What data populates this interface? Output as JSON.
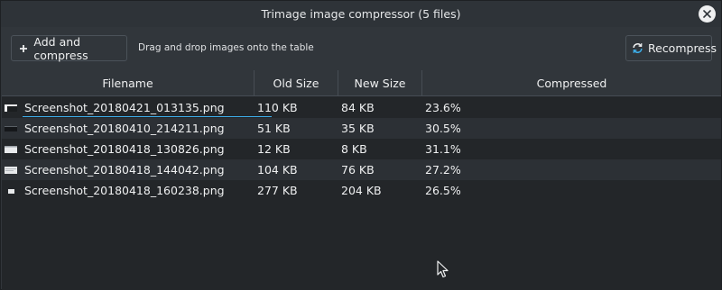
{
  "window": {
    "title": "Trimage image compressor (5 files)"
  },
  "toolbar": {
    "add_label": "Add and compress",
    "hint": "Drag and drop images onto the table",
    "recompress_label": "Recompress"
  },
  "table": {
    "headers": [
      "Filename",
      "Old Size",
      "New Size",
      "Compressed"
    ],
    "rows": [
      {
        "filename": "Screenshot_20180421_013135.png",
        "old_size": "110 KB",
        "new_size": "84 KB",
        "compressed": "23.6%"
      },
      {
        "filename": "Screenshot_20180410_214211.png",
        "old_size": "51 KB",
        "new_size": "35 KB",
        "compressed": "30.5%"
      },
      {
        "filename": "Screenshot_20180418_130826.png",
        "old_size": "12 KB",
        "new_size": "8 KB",
        "compressed": "31.1%"
      },
      {
        "filename": "Screenshot_20180418_144042.png",
        "old_size": "104 KB",
        "new_size": "76 KB",
        "compressed": "27.2%"
      },
      {
        "filename": "Screenshot_20180418_160238.png",
        "old_size": "277 KB",
        "new_size": "204 KB",
        "compressed": "26.5%"
      }
    ]
  },
  "colors": {
    "background": "#31363b",
    "table_background": "#232629",
    "accent": "#3daee9"
  },
  "icons": {
    "add": "plus-icon",
    "recompress": "refresh-icon",
    "close": "close-icon"
  }
}
